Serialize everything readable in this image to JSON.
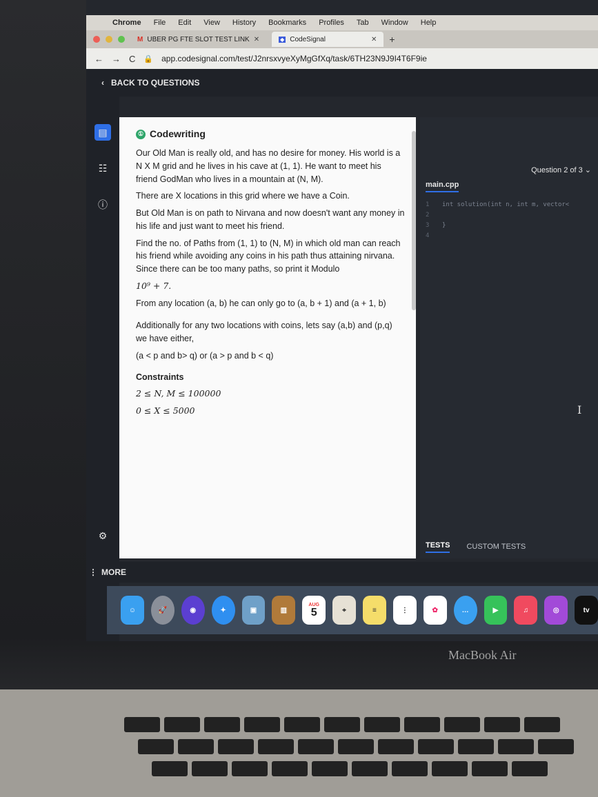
{
  "menubar": {
    "app": "Chrome",
    "items": [
      "File",
      "Edit",
      "View",
      "History",
      "Bookmarks",
      "Profiles",
      "Tab",
      "Window",
      "Help"
    ]
  },
  "tabs": [
    {
      "label": "UBER PG FTE SLOT TEST LINK",
      "icon": "gmail-icon"
    },
    {
      "label": "CodeSignal",
      "icon": "codesignal-icon"
    }
  ],
  "address": {
    "url": "app.codesignal.com/test/J2nrsxvyeXyMgGfXq/task/6TH23N9J9I4T6F9ie"
  },
  "topnav": {
    "back_label": "BACK TO QUESTIONS"
  },
  "task": {
    "title": "Codewriting",
    "paragraphs": [
      "Our Old Man is really old, and has no desire for money. His world is a N X M grid and he lives in his cave at (1, 1). He want to meet his friend GodMan who lives in a mountain at (N, M).",
      "There are X locations in this grid where we have a Coin.",
      "But Old Man is on path to Nirvana and now doesn't want any money in his life and just want to meet his friend.",
      "Find the no. of Paths from (1, 1) to (N, M) in which old man can reach his friend while avoiding any coins in his path thus attaining nirvana. Since there can be too many paths, so print it Modulo",
      "10⁹ + 7.",
      "From any location (a, b) he can only go to (a, b + 1) and (a + 1, b)",
      "Additionally for any two locations with coins, lets say (a,b) and (p,q) we have either,",
      "(a < p and b> q) or (a > p and b < q)"
    ],
    "constraints_label": "Constraints",
    "constraints": [
      "2 ≤ N, M ≤ 100000",
      "0 ≤ X ≤ 5000"
    ]
  },
  "editor": {
    "question_label": "Question 2 of 3",
    "file_tab": "main.cpp",
    "lines": [
      {
        "n": "1",
        "code": "int solution(int n, int m, vector<"
      },
      {
        "n": "2",
        "code": ""
      },
      {
        "n": "3",
        "code": "}"
      },
      {
        "n": "4",
        "code": ""
      }
    ],
    "tests_tab": "TESTS",
    "custom_tests_tab": "CUSTOM TESTS"
  },
  "bottom": {
    "more_label": "MORE"
  },
  "dock": {
    "apps": [
      "finder",
      "launchpad",
      "siri",
      "safari",
      "preview",
      "notes",
      "calendar",
      "maps",
      "stickies",
      "reminders",
      "photos",
      "messages",
      "facetime",
      "music",
      "podcasts",
      "tv"
    ],
    "calendar_month": "AUG",
    "calendar_day": "5",
    "tv_label": "tv"
  },
  "device": {
    "brand": "MacBook Air"
  }
}
